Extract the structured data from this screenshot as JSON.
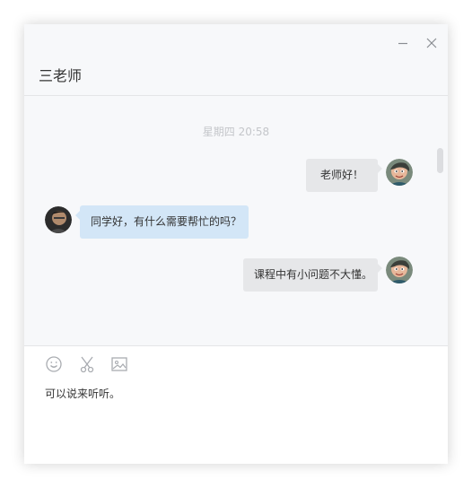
{
  "window": {
    "title": "三老师"
  },
  "controls": {
    "minimize_icon": "minimize-icon",
    "close_icon": "close-icon"
  },
  "conversation": {
    "timestamp": "星期四  20:58",
    "messages": [
      {
        "side": "right",
        "text": "老师好！"
      },
      {
        "side": "left",
        "text": "同学好，有什么需要帮忙的吗？"
      },
      {
        "side": "right",
        "text": "课程中有小问题不大懂。"
      }
    ]
  },
  "toolbar": {
    "icons": [
      "emoji-icon",
      "scissors-icon",
      "image-icon"
    ]
  },
  "composer": {
    "value": "可以说来听听。"
  },
  "colors": {
    "own_bubble": "#e6e7e9",
    "other_bubble": "#d3e6f7",
    "window_bg": "#f7f8fa"
  }
}
